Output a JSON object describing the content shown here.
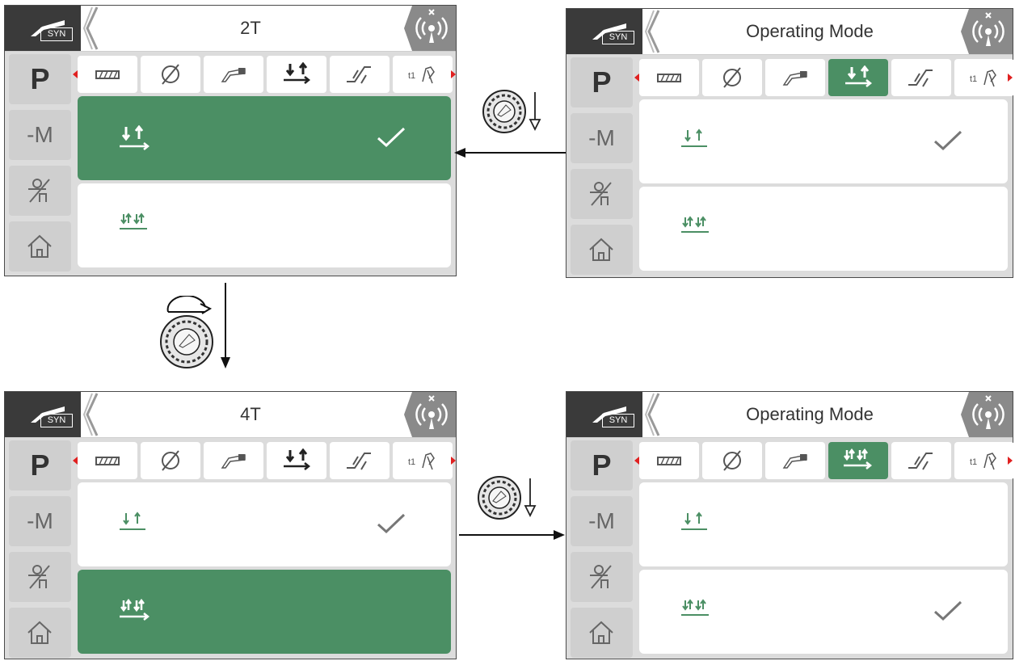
{
  "screens": [
    {
      "title": "2T",
      "header_badge": "SYN",
      "side": [
        "P",
        "-M"
      ],
      "tab_text": "t1"
    },
    {
      "title": "Operating Mode",
      "header_badge": "SYN",
      "side": [
        "P",
        "-M"
      ],
      "tab_text": "t1"
    },
    {
      "title": "4T",
      "header_badge": "SYN",
      "side": [
        "P",
        "-M"
      ],
      "tab_text": "t1"
    },
    {
      "title": "Operating Mode",
      "header_badge": "SYN",
      "side": [
        "P",
        "-M"
      ],
      "tab_text": "t1"
    }
  ],
  "colors": {
    "accent": "#4b8f64",
    "indicator": "#e02020",
    "header_dark": "#3a3a3a"
  },
  "icons": [
    "welding-gun-icon",
    "back-chevron-icon",
    "wireless-off-icon",
    "ground-clamp-icon",
    "home-icon",
    "material-icon",
    "diameter-icon",
    "torch-icon",
    "trigger-mode-icon",
    "slope-icon",
    "timer-icon",
    "2t-mode-icon",
    "4t-mode-icon",
    "check-icon",
    "knob-icon"
  ]
}
